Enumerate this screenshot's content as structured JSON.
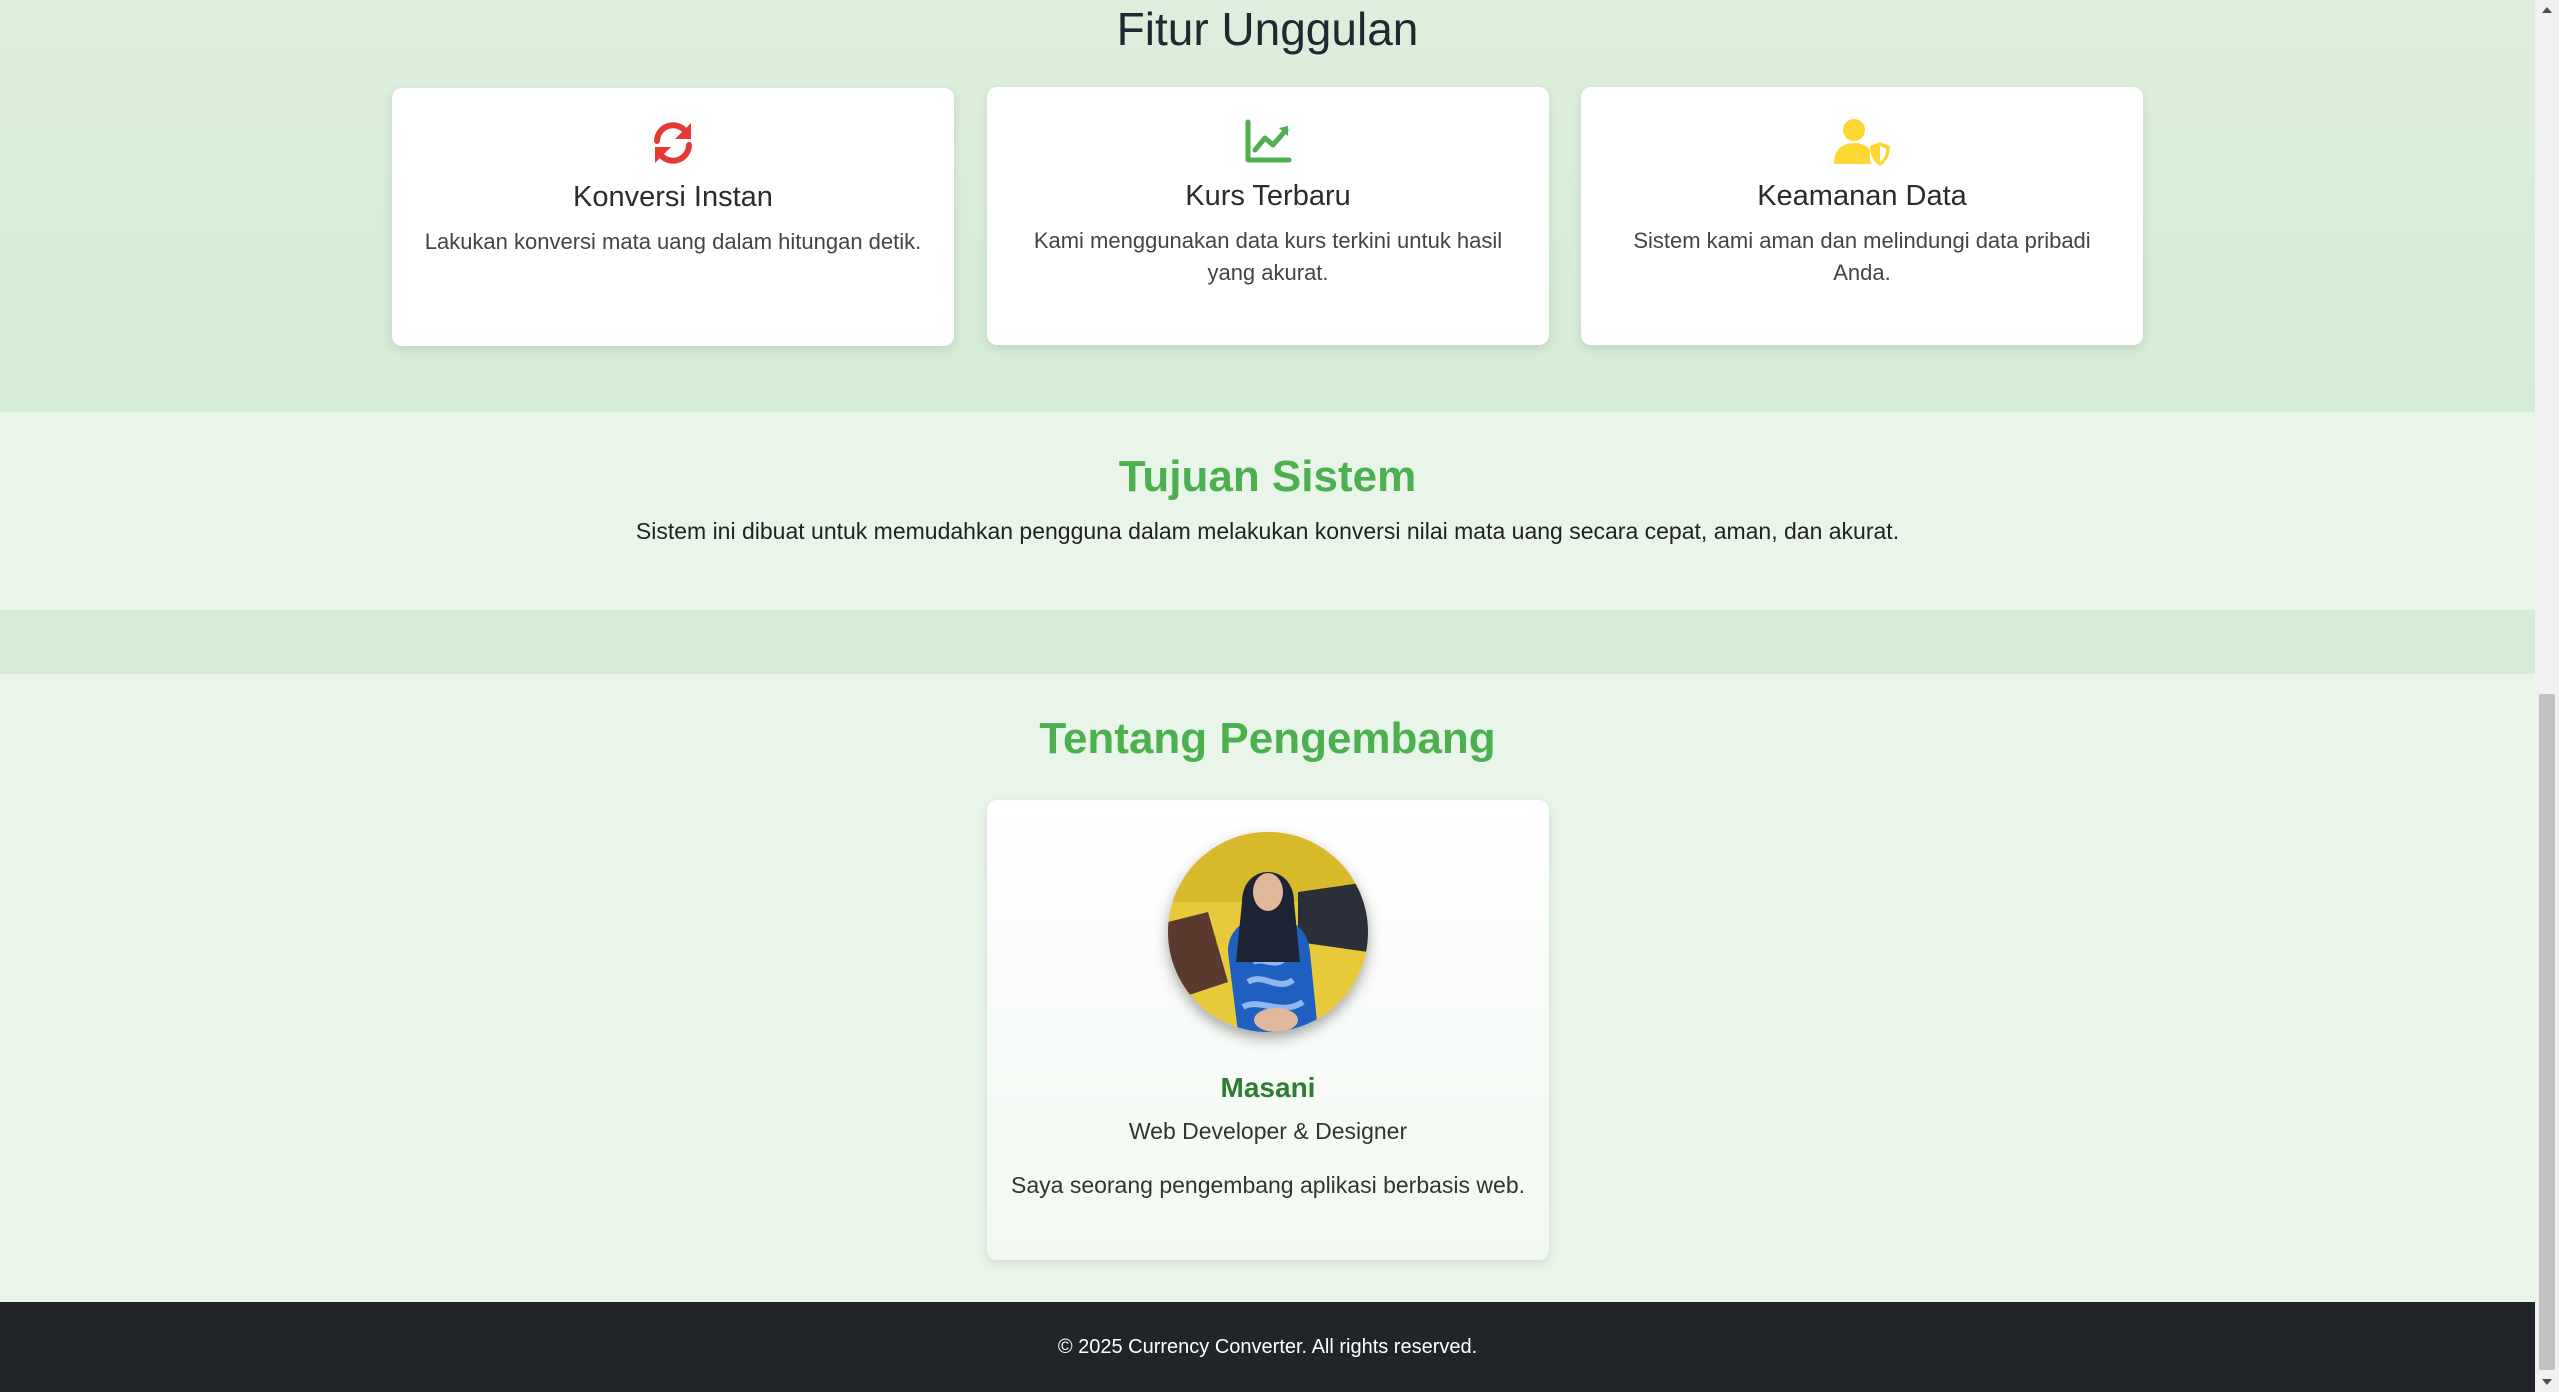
{
  "features": {
    "title": "Fitur Unggulan",
    "cards": [
      {
        "icon": "sync-icon",
        "icon_color": "#e53935",
        "title": "Konversi Instan",
        "description": "Lakukan konversi mata uang dalam hitungan detik."
      },
      {
        "icon": "chart-line-icon",
        "icon_color": "#4caf50",
        "title": "Kurs Terbaru",
        "description": "Kami menggunakan data kurs terkini untuk hasil yang akurat."
      },
      {
        "icon": "user-shield-icon",
        "icon_color": "#fdd835",
        "title": "Keamanan Data",
        "description": "Sistem kami aman dan melindungi data pribadi Anda."
      }
    ]
  },
  "purpose": {
    "title": "Tujuan Sistem",
    "text": "Sistem ini dibuat untuk memudahkan pengguna dalam melakukan konversi nilai mata uang secara cepat, aman, dan akurat."
  },
  "developer": {
    "title": "Tentang Pengembang",
    "name": "Masani",
    "role": "Web Developer & Designer",
    "bio": "Saya seorang pengembang aplikasi berbasis web."
  },
  "footer": {
    "text": "© 2025 Currency Converter. All rights reserved."
  },
  "colors": {
    "accent_green": "#4caf50",
    "dark_green": "#2e7d32",
    "footer_bg": "#212529",
    "section_bg_light": "#e8f5e8",
    "section_bg": "#d4ebd5"
  }
}
